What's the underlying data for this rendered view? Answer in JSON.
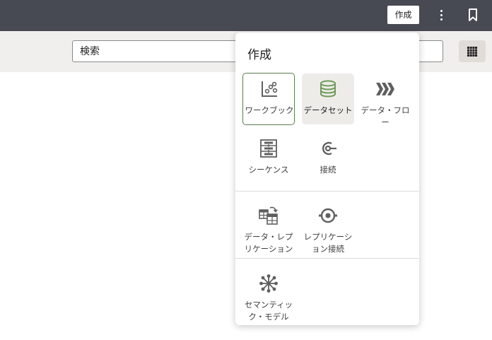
{
  "header": {
    "create_label": "作成",
    "menu_icon": "kebab-icon",
    "bookmark_icon": "bookmark-icon"
  },
  "search": {
    "placeholder": "検索"
  },
  "grid_icon": "grid-icon",
  "popup": {
    "title": "作成",
    "items": [
      {
        "label": "ワークブック",
        "icon": "workbook-icon",
        "state": "selected"
      },
      {
        "label": "データセット",
        "icon": "dataset-icon",
        "state": "hover"
      },
      {
        "label": "データ・フロー",
        "icon": "dataflow-icon",
        "state": "normal"
      },
      {
        "label": "シーケンス",
        "icon": "sequence-icon",
        "state": "normal"
      },
      {
        "label": "接続",
        "icon": "connection-icon",
        "state": "normal"
      },
      {
        "label": "データ・レプリケーション",
        "icon": "data-replication-icon",
        "state": "normal"
      },
      {
        "label": "レプリケーション接続",
        "icon": "replication-connection-icon",
        "state": "normal"
      },
      {
        "label": "セマンティック・モデル",
        "icon": "semantic-model-icon",
        "state": "normal"
      }
    ]
  },
  "colors": {
    "header_bg": "#474a52",
    "subbar_bg": "#f1efed",
    "icon_gray": "#5f5f5f",
    "dataset_green": "#6f9b5b",
    "selected_border": "#5a7d4f"
  }
}
